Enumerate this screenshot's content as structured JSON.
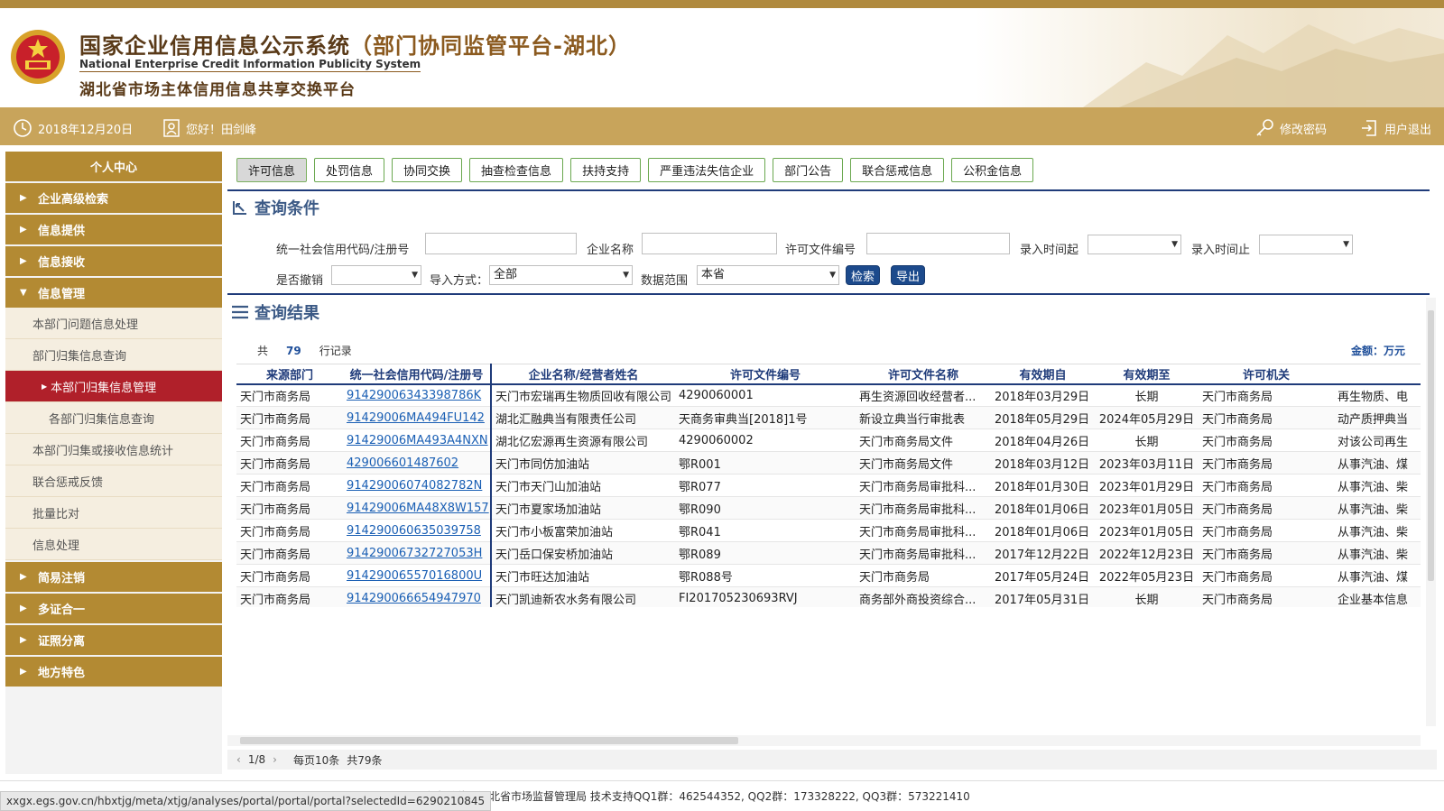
{
  "header": {
    "title_cn": "国家企业信用信息公示系统",
    "title_sub": "（部门协同监管平台-湖北）",
    "title_en": "National Enterprise Credit Information Publicity System",
    "subtitle": "湖北省市场主体信用信息共享交换平台"
  },
  "userbar": {
    "date": "2018年12月20日",
    "greeting": "您好！田剑峰",
    "change_password": "修改密码",
    "logout": "用户退出"
  },
  "sidebar": {
    "personal": "个人中心",
    "items": [
      {
        "label": "企业高级检索"
      },
      {
        "label": "信息提供"
      },
      {
        "label": "信息接收"
      },
      {
        "label": "信息管理"
      }
    ],
    "subitems": [
      {
        "label": "本部门问题信息处理"
      },
      {
        "label": "部门归集信息查询"
      },
      {
        "label": "本部门归集信息管理"
      },
      {
        "label": "各部门归集信息查询"
      },
      {
        "label": "本部门归集或接收信息统计"
      },
      {
        "label": "联合惩戒反馈"
      },
      {
        "label": "批量比对"
      },
      {
        "label": "信息处理"
      }
    ],
    "bottom": [
      {
        "label": "简易注销"
      },
      {
        "label": "多证合一"
      },
      {
        "label": "证照分离"
      },
      {
        "label": "地方特色"
      }
    ]
  },
  "tabs": [
    "许可信息",
    "处罚信息",
    "协同交换",
    "抽查检查信息",
    "扶持支持",
    "严重违法失信企业",
    "部门公告",
    "联合惩戒信息",
    "公积金信息"
  ],
  "query": {
    "title": "查询条件",
    "label_code": "统一社会信用代码/注册号",
    "label_name": "企业名称",
    "label_permit": "许可文件编号",
    "label_start": "录入时间起",
    "label_end": "录入时间止",
    "label_revoked": "是否撤销",
    "label_import": "导入方式：",
    "import_value": "全部",
    "label_scope": "数据范围",
    "scope_value": "本省",
    "search": "检索",
    "export": "导出"
  },
  "result": {
    "title": "查询结果",
    "total_prefix": "共",
    "total": "79",
    "total_suffix": "行记录",
    "unit": "金额：万元",
    "columns": [
      "来源部门",
      "统一社会信用代码/注册号",
      "企业名称/经营者姓名",
      "许可文件编号",
      "许可文件名称",
      "有效期自",
      "有效期至",
      "许可机关",
      ""
    ],
    "rows": [
      [
        "天门市商务局",
        "91429006343398786K",
        "天门市宏瑞再生物质回收有限公司",
        "4290060001",
        "再生资源回收经营者...",
        "2018年03月29日",
        "长期",
        "天门市商务局",
        "再生物质、电"
      ],
      [
        "天门市商务局",
        "91429006MA494FU142",
        "湖北汇融典当有限责任公司",
        "天商务审典当[2018]1号",
        "新设立典当行审批表",
        "2018年05月29日",
        "2024年05月29日",
        "天门市商务局",
        "动产质押典当"
      ],
      [
        "天门市商务局",
        "91429006MA493A4NXN",
        "湖北亿宏源再生资源有限公司",
        "4290060002",
        "天门市商务局文件",
        "2018年04月26日",
        "长期",
        "天门市商务局",
        "对该公司再生"
      ],
      [
        "天门市商务局",
        "429006601487602",
        "天门市同仿加油站",
        "鄂R001",
        "天门市商务局文件",
        "2018年03月12日",
        "2023年03月11日",
        "天门市商务局",
        "从事汽油、煤"
      ],
      [
        "天门市商务局",
        "91429006074082782N",
        "天门市天门山加油站",
        "鄂R077",
        "天门市商务局审批科...",
        "2018年01月30日",
        "2023年01月29日",
        "天门市商务局",
        "从事汽油、柴"
      ],
      [
        "天门市商务局",
        "91429006MA48X8W157",
        "天门市夏家场加油站",
        "鄂R090",
        "天门市商务局审批科...",
        "2018年01月06日",
        "2023年01月05日",
        "天门市商务局",
        "从事汽油、柴"
      ],
      [
        "天门市商务局",
        "914290060635039758",
        "天门市小板富荣加油站",
        "鄂R041",
        "天门市商务局审批科...",
        "2018年01月06日",
        "2023年01月05日",
        "天门市商务局",
        "从事汽油、柴"
      ],
      [
        "天门市商务局",
        "91429006732727053H",
        "天门岳口保安桥加油站",
        "鄂R089",
        "天门市商务局审批科...",
        "2017年12月22日",
        "2022年12月23日",
        "天门市商务局",
        "从事汽油、柴"
      ],
      [
        "天门市商务局",
        "91429006557016800U",
        "天门市旺达加油站",
        "鄂R088号",
        "天门市商务局",
        "2017年05月24日",
        "2022年05月23日",
        "天门市商务局",
        "从事汽油、煤"
      ],
      [
        "天门市商务局",
        "914290066654947970",
        "天门凯迪新农水务有限公司",
        "FI201705230693RVJ",
        "商务部外商投资综合...",
        "2017年05月31日",
        "长期",
        "天门市商务局",
        "企业基本信息"
      ]
    ]
  },
  "pager": {
    "page": "1/8",
    "per_page": "每页10条",
    "total": "共79条"
  },
  "footer": {
    "text": "主办单位：湖北省市场监督管理局    技术支持QQ1群：462544352, QQ2群：173328222, QQ3群：573221410"
  },
  "statusbar": {
    "url": "xxgx.egs.gov.cn/hbxtjg/meta/xtjg/analyses/portal/portal/portal?selectedId=6290210845"
  },
  "colors": {
    "gold": "#c8a45b",
    "sidebar_gold": "#b38a33",
    "active_red": "#b0202a",
    "navy": "#1f3b7a",
    "link": "#1a5fb4"
  }
}
